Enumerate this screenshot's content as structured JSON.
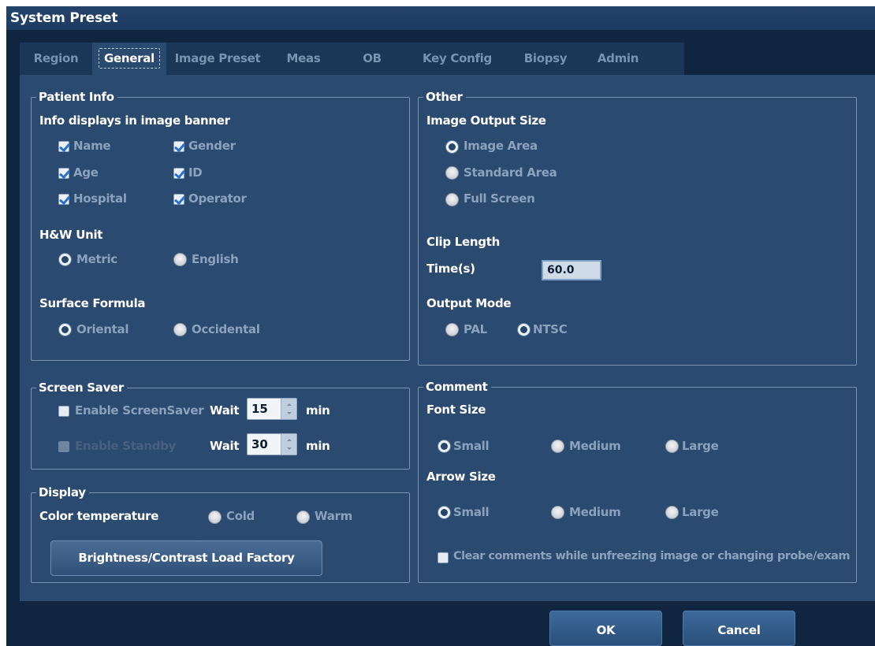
{
  "window": {
    "title": "System Preset"
  },
  "tabs": [
    {
      "label": "Region"
    },
    {
      "label": "General"
    },
    {
      "label": "Image Preset"
    },
    {
      "label": "Meas"
    },
    {
      "label": "OB"
    },
    {
      "label": "Key Config"
    },
    {
      "label": "Biopsy"
    },
    {
      "label": "Admin"
    }
  ],
  "active_tab": "General",
  "patient_info": {
    "legend": "Patient Info",
    "banner_heading": "Info displays in image banner",
    "fields": [
      {
        "label": "Name",
        "checked": true
      },
      {
        "label": "Gender",
        "checked": true
      },
      {
        "label": "Age",
        "checked": true
      },
      {
        "label": "ID",
        "checked": true
      },
      {
        "label": "Hospital",
        "checked": true
      },
      {
        "label": "Operator",
        "checked": true
      }
    ],
    "hw_unit": {
      "heading": "H&W Unit",
      "options": [
        "Metric",
        "English"
      ],
      "selected": "Metric"
    },
    "surface_formula": {
      "heading": "Surface Formula",
      "options": [
        "Oriental",
        "Occidental"
      ],
      "selected": "Oriental"
    }
  },
  "other": {
    "legend": "Other",
    "image_output": {
      "heading": "Image Output Size",
      "options": [
        "Image Area",
        "Standard Area",
        "Full Screen"
      ],
      "selected": "Image Area"
    },
    "clip_length": {
      "heading": "Clip Length",
      "time_label": "Time(s)",
      "time_value": "60.0"
    },
    "output_mode": {
      "heading": "Output Mode",
      "options": [
        "PAL",
        "NTSC"
      ],
      "selected": "NTSC"
    }
  },
  "screen_saver": {
    "legend": "Screen Saver",
    "enable_screensaver": {
      "label": "Enable ScreenSaver",
      "checked": false
    },
    "enable_standby": {
      "label": "Enable Standby",
      "checked": false,
      "disabled": true
    },
    "wait_label": "Wait",
    "wait1": "15",
    "wait2": "30",
    "unit": "min"
  },
  "display": {
    "legend": "Display",
    "color_temp_label": "Color temperature",
    "options": [
      "Cold",
      "Warm"
    ],
    "selected": null,
    "factory_button": "Brightness/Contrast Load Factory"
  },
  "comment": {
    "legend": "Comment",
    "font_size": {
      "heading": "Font Size",
      "options": [
        "Small",
        "Medium",
        "Large"
      ],
      "selected": "Small"
    },
    "arrow_size": {
      "heading": "Arrow Size",
      "options": [
        "Small",
        "Medium",
        "Large"
      ],
      "selected": "Small"
    },
    "clear_comments": {
      "label": "Clear comments while unfreezing image or changing probe/exam",
      "checked": false
    }
  },
  "footer": {
    "ok": "OK",
    "cancel": "Cancel"
  }
}
